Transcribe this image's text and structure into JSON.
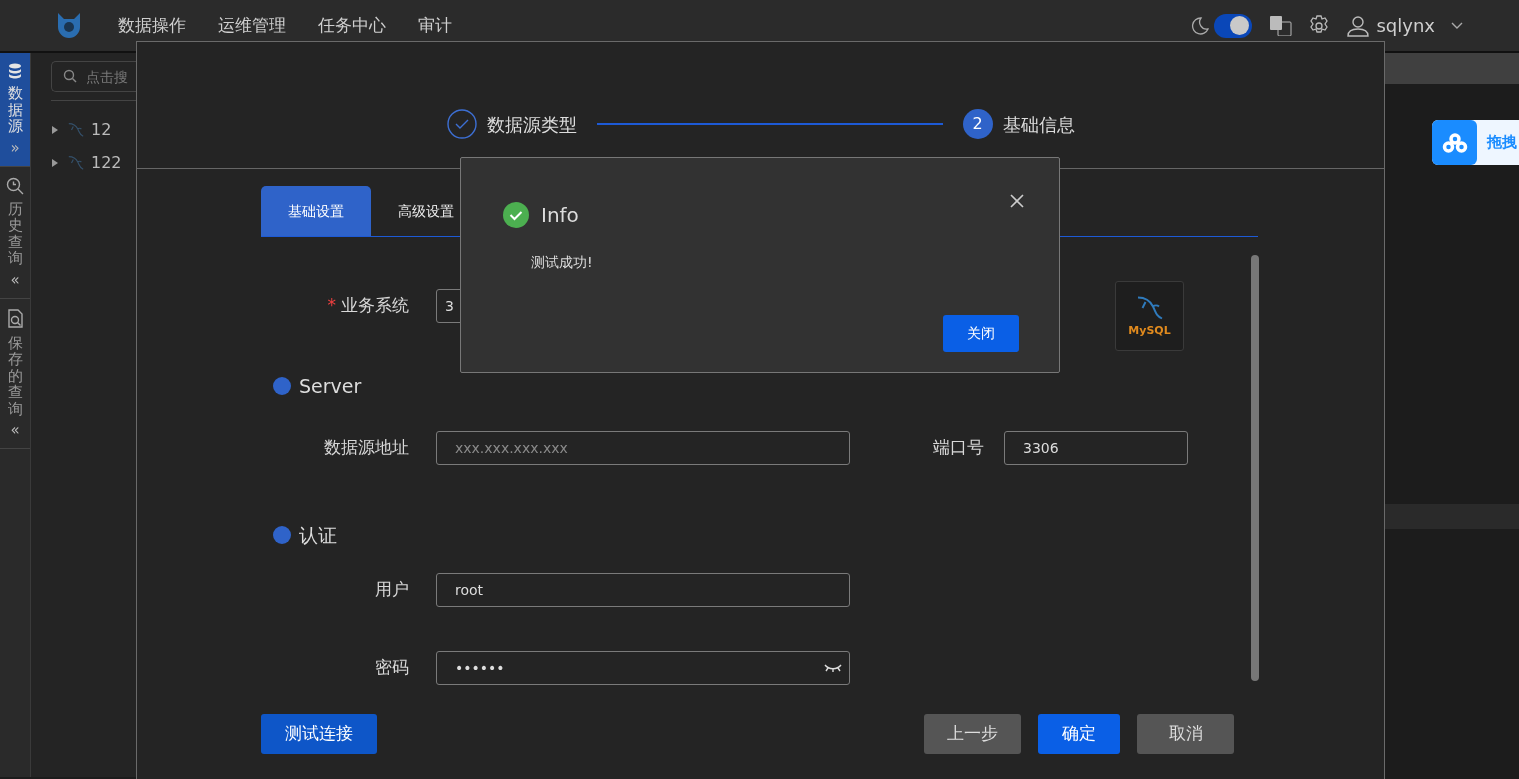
{
  "top_bar": {
    "nav": [
      {
        "label": "数据操作"
      },
      {
        "label": "运维管理"
      },
      {
        "label": "任务中心"
      },
      {
        "label": "审计"
      }
    ],
    "dark_mode": {
      "on": true
    },
    "user": "sqlynx"
  },
  "sidebar_rail": [
    {
      "kind": "database",
      "label": "数据源",
      "selected": true,
      "toggle": "»"
    },
    {
      "kind": "history",
      "label": "历史查询",
      "selected": false,
      "toggle": "«"
    },
    {
      "kind": "saved",
      "label": "保存的查询",
      "selected": false,
      "toggle": "«"
    }
  ],
  "tree": {
    "search_placeholder": "点击搜",
    "items": [
      {
        "label": "12",
        "expanded": false
      },
      {
        "label": "122",
        "expanded": false
      }
    ]
  },
  "floating_widget": {
    "label": "拖拽"
  },
  "wizard": {
    "steps": [
      {
        "label": "数据源类型",
        "done": true
      },
      {
        "label": "基础信息",
        "done": false,
        "number": "2"
      }
    ],
    "tabs": [
      {
        "label": "基础设置",
        "selected": true
      },
      {
        "label": "高级设置",
        "selected": false
      }
    ],
    "business_system": {
      "label": "业务系统",
      "required_mark": "*",
      "value": "3"
    },
    "db_logo": "MySQL",
    "sections": [
      {
        "title": "Server",
        "fields": [
          {
            "label": "数据源地址",
            "placeholder": "xxx.xxx.xxx.xxx"
          },
          {
            "label": "端口号",
            "value": "3306"
          }
        ]
      },
      {
        "title": "认证",
        "fields": [
          {
            "label": "用户",
            "value": "root",
            "kind": "text"
          },
          {
            "label": "密码",
            "value": "••••••",
            "kind": "password"
          }
        ]
      }
    ],
    "buttons": [
      {
        "label": "测试连接",
        "kind": "test"
      },
      {
        "label": "上一步",
        "kind": "secondary"
      },
      {
        "label": "确定",
        "kind": "primary"
      },
      {
        "label": "取消",
        "kind": "secondary"
      }
    ]
  },
  "dialog": {
    "title": "Info",
    "message": "测试成功!",
    "button": "关闭"
  }
}
